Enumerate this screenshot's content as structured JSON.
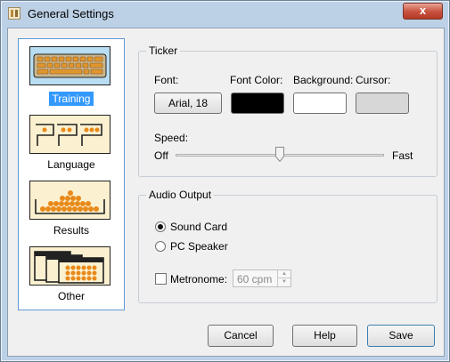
{
  "window": {
    "title": "General Settings",
    "close_glyph": "x"
  },
  "sidebar": {
    "items": [
      {
        "label": "Training",
        "icon": "keyboard-icon",
        "selected": true
      },
      {
        "label": "Language",
        "icon": "language-icon",
        "selected": false
      },
      {
        "label": "Results",
        "icon": "results-icon",
        "selected": false
      },
      {
        "label": "Other",
        "icon": "other-icon",
        "selected": false
      }
    ]
  },
  "ticker": {
    "title": "Ticker",
    "font_label": "Font:",
    "font_value": "Arial, 18",
    "font_color_label": "Font Color:",
    "background_label": "Background:",
    "cursor_label": "Cursor:",
    "colors": {
      "font_color": "#000000",
      "background": "#ffffff",
      "cursor": "#d7d7d7"
    },
    "speed_label": "Speed:",
    "speed_min_label": "Off",
    "speed_max_label": "Fast",
    "speed_value": 0.5
  },
  "audio": {
    "title": "Audio Output",
    "options": [
      "Sound Card",
      "PC Speaker"
    ],
    "selected_option": "Sound Card",
    "metronome_label": "Metronome:",
    "metronome_checked": false,
    "metronome_value": "60 cpm"
  },
  "footer": {
    "cancel_label": "Cancel",
    "help_label": "Help",
    "save_label": "Save"
  }
}
